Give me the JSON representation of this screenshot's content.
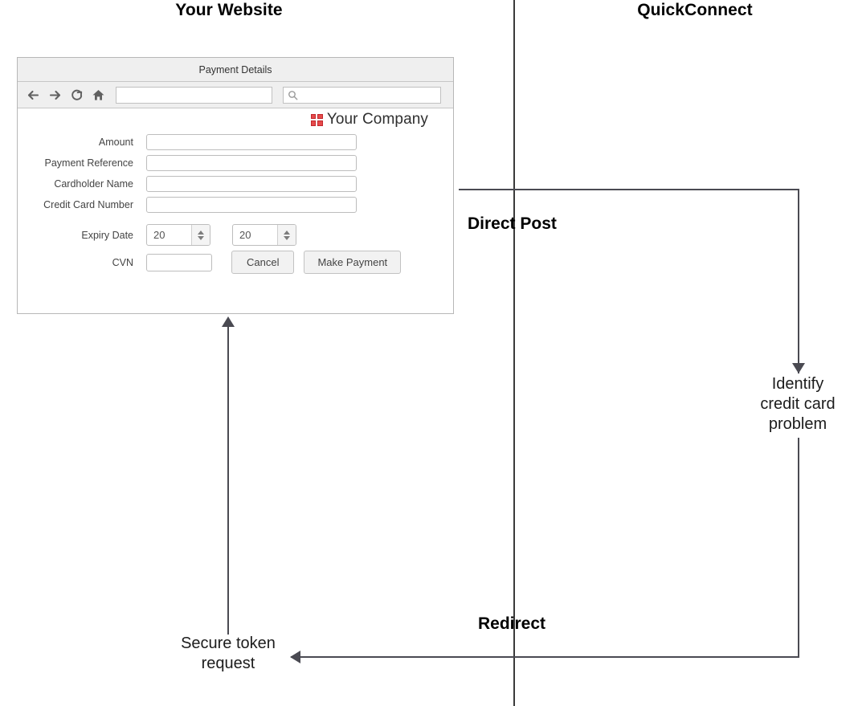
{
  "lanes": {
    "left_title": "Your Website",
    "right_title": "QuickConnect"
  },
  "browser": {
    "window_title": "Payment Details",
    "toolbar": {
      "back_icon": "back-arrow-icon",
      "forward_icon": "forward-arrow-icon",
      "reload_icon": "reload-icon",
      "home_icon": "home-icon",
      "url_value": "",
      "url_placeholder": "",
      "search_icon": "search-icon",
      "search_value": "",
      "search_placeholder": ""
    }
  },
  "brand": {
    "logo_icon": "four-squares-logo-icon",
    "logo_color": "#c1272d",
    "name": "Your Company"
  },
  "form": {
    "fields": [
      {
        "label": "Amount",
        "value": "",
        "placeholder": ""
      },
      {
        "label": "Payment Reference",
        "value": "",
        "placeholder": ""
      },
      {
        "label": "Cardholder Name",
        "value": "",
        "placeholder": ""
      },
      {
        "label": "Credit Card Number",
        "value": "",
        "placeholder": ""
      }
    ],
    "expiry": {
      "label": "Expiry Date",
      "month_value": "20",
      "year_value": "20"
    },
    "cvn": {
      "label": "CVN",
      "value": "",
      "placeholder": ""
    },
    "buttons": {
      "cancel": "Cancel",
      "submit": "Make Payment"
    }
  },
  "flow": {
    "direct_post_label": "Direct Post",
    "redirect_label": "Redirect",
    "identify_note": "Identify\ncredit card\nproblem",
    "identify_note_line1": "Identify",
    "identify_note_line2": "credit card",
    "identify_note_line3": "problem",
    "secure_token_note_line1": "Secure token",
    "secure_token_note_line2": "request"
  },
  "colors": {
    "connector": "#4a4a52",
    "divider": "#3a3a3a",
    "panel_border": "#b7b7b7",
    "panel_header": "#efefef",
    "brand_red": "#c1272d"
  }
}
